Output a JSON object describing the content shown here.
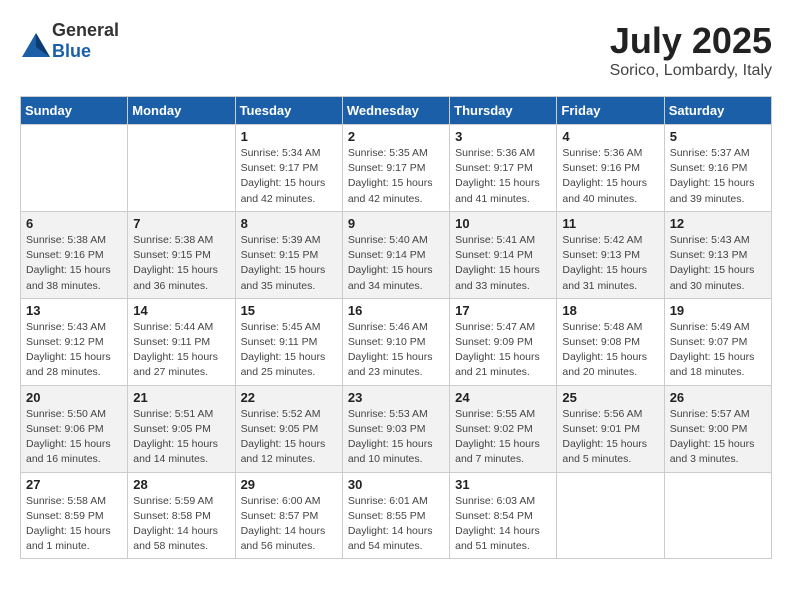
{
  "header": {
    "logo_general": "General",
    "logo_blue": "Blue",
    "month_year": "July 2025",
    "location": "Sorico, Lombardy, Italy"
  },
  "days_of_week": [
    "Sunday",
    "Monday",
    "Tuesday",
    "Wednesday",
    "Thursday",
    "Friday",
    "Saturday"
  ],
  "weeks": [
    [
      {
        "day": "",
        "info": ""
      },
      {
        "day": "",
        "info": ""
      },
      {
        "day": "1",
        "info": "Sunrise: 5:34 AM\nSunset: 9:17 PM\nDaylight: 15 hours\nand 42 minutes."
      },
      {
        "day": "2",
        "info": "Sunrise: 5:35 AM\nSunset: 9:17 PM\nDaylight: 15 hours\nand 42 minutes."
      },
      {
        "day": "3",
        "info": "Sunrise: 5:36 AM\nSunset: 9:17 PM\nDaylight: 15 hours\nand 41 minutes."
      },
      {
        "day": "4",
        "info": "Sunrise: 5:36 AM\nSunset: 9:16 PM\nDaylight: 15 hours\nand 40 minutes."
      },
      {
        "day": "5",
        "info": "Sunrise: 5:37 AM\nSunset: 9:16 PM\nDaylight: 15 hours\nand 39 minutes."
      }
    ],
    [
      {
        "day": "6",
        "info": "Sunrise: 5:38 AM\nSunset: 9:16 PM\nDaylight: 15 hours\nand 38 minutes."
      },
      {
        "day": "7",
        "info": "Sunrise: 5:38 AM\nSunset: 9:15 PM\nDaylight: 15 hours\nand 36 minutes."
      },
      {
        "day": "8",
        "info": "Sunrise: 5:39 AM\nSunset: 9:15 PM\nDaylight: 15 hours\nand 35 minutes."
      },
      {
        "day": "9",
        "info": "Sunrise: 5:40 AM\nSunset: 9:14 PM\nDaylight: 15 hours\nand 34 minutes."
      },
      {
        "day": "10",
        "info": "Sunrise: 5:41 AM\nSunset: 9:14 PM\nDaylight: 15 hours\nand 33 minutes."
      },
      {
        "day": "11",
        "info": "Sunrise: 5:42 AM\nSunset: 9:13 PM\nDaylight: 15 hours\nand 31 minutes."
      },
      {
        "day": "12",
        "info": "Sunrise: 5:43 AM\nSunset: 9:13 PM\nDaylight: 15 hours\nand 30 minutes."
      }
    ],
    [
      {
        "day": "13",
        "info": "Sunrise: 5:43 AM\nSunset: 9:12 PM\nDaylight: 15 hours\nand 28 minutes."
      },
      {
        "day": "14",
        "info": "Sunrise: 5:44 AM\nSunset: 9:11 PM\nDaylight: 15 hours\nand 27 minutes."
      },
      {
        "day": "15",
        "info": "Sunrise: 5:45 AM\nSunset: 9:11 PM\nDaylight: 15 hours\nand 25 minutes."
      },
      {
        "day": "16",
        "info": "Sunrise: 5:46 AM\nSunset: 9:10 PM\nDaylight: 15 hours\nand 23 minutes."
      },
      {
        "day": "17",
        "info": "Sunrise: 5:47 AM\nSunset: 9:09 PM\nDaylight: 15 hours\nand 21 minutes."
      },
      {
        "day": "18",
        "info": "Sunrise: 5:48 AM\nSunset: 9:08 PM\nDaylight: 15 hours\nand 20 minutes."
      },
      {
        "day": "19",
        "info": "Sunrise: 5:49 AM\nSunset: 9:07 PM\nDaylight: 15 hours\nand 18 minutes."
      }
    ],
    [
      {
        "day": "20",
        "info": "Sunrise: 5:50 AM\nSunset: 9:06 PM\nDaylight: 15 hours\nand 16 minutes."
      },
      {
        "day": "21",
        "info": "Sunrise: 5:51 AM\nSunset: 9:05 PM\nDaylight: 15 hours\nand 14 minutes."
      },
      {
        "day": "22",
        "info": "Sunrise: 5:52 AM\nSunset: 9:05 PM\nDaylight: 15 hours\nand 12 minutes."
      },
      {
        "day": "23",
        "info": "Sunrise: 5:53 AM\nSunset: 9:03 PM\nDaylight: 15 hours\nand 10 minutes."
      },
      {
        "day": "24",
        "info": "Sunrise: 5:55 AM\nSunset: 9:02 PM\nDaylight: 15 hours\nand 7 minutes."
      },
      {
        "day": "25",
        "info": "Sunrise: 5:56 AM\nSunset: 9:01 PM\nDaylight: 15 hours\nand 5 minutes."
      },
      {
        "day": "26",
        "info": "Sunrise: 5:57 AM\nSunset: 9:00 PM\nDaylight: 15 hours\nand 3 minutes."
      }
    ],
    [
      {
        "day": "27",
        "info": "Sunrise: 5:58 AM\nSunset: 8:59 PM\nDaylight: 15 hours\nand 1 minute."
      },
      {
        "day": "28",
        "info": "Sunrise: 5:59 AM\nSunset: 8:58 PM\nDaylight: 14 hours\nand 58 minutes."
      },
      {
        "day": "29",
        "info": "Sunrise: 6:00 AM\nSunset: 8:57 PM\nDaylight: 14 hours\nand 56 minutes."
      },
      {
        "day": "30",
        "info": "Sunrise: 6:01 AM\nSunset: 8:55 PM\nDaylight: 14 hours\nand 54 minutes."
      },
      {
        "day": "31",
        "info": "Sunrise: 6:03 AM\nSunset: 8:54 PM\nDaylight: 14 hours\nand 51 minutes."
      },
      {
        "day": "",
        "info": ""
      },
      {
        "day": "",
        "info": ""
      }
    ]
  ]
}
